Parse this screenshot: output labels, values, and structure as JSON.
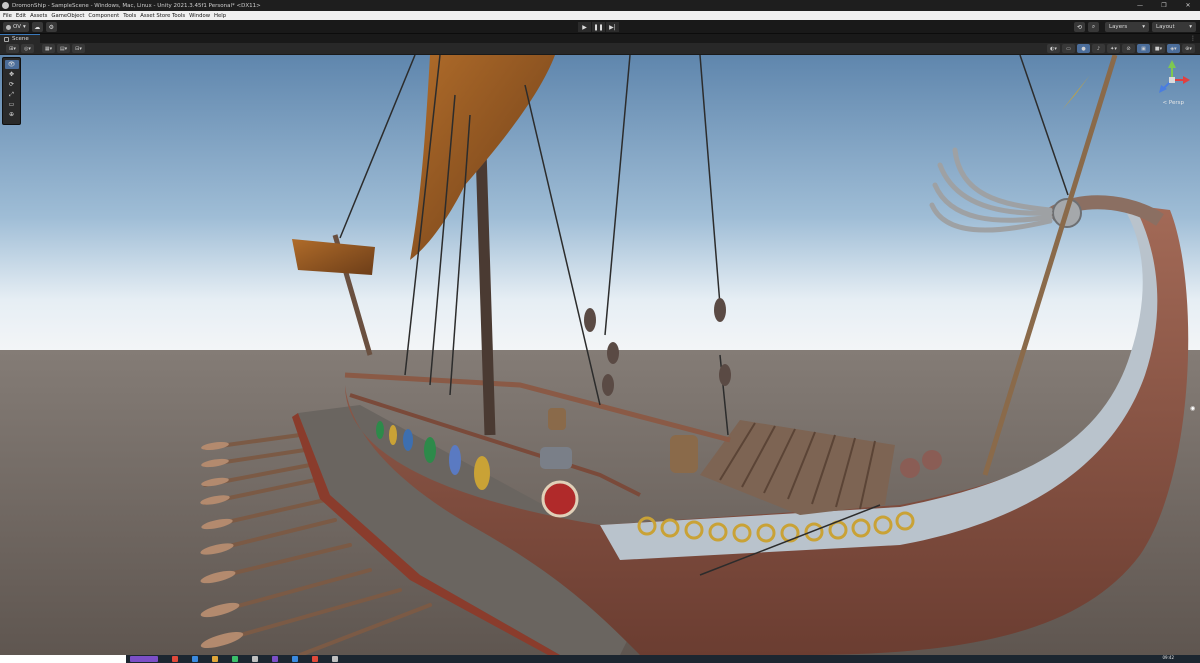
{
  "window": {
    "title": "DromonShip - SampleScene - Windows, Mac, Linux - Unity 2021.3.45f1 Personal* <DX11>",
    "controls": [
      "—",
      "❐",
      "✕"
    ]
  },
  "menu": {
    "items": [
      "File",
      "Edit",
      "Assets",
      "GameObject",
      "Component",
      "Tools",
      "Asset Store Tools",
      "Window",
      "Help"
    ]
  },
  "toolbar": {
    "account_label": "OV",
    "account_icon": "account-icon",
    "cloud_icon": "cloud-icon",
    "settings_icon": "gear-icon",
    "play_icons": [
      "play-icon",
      "pause-icon",
      "step-icon"
    ],
    "play_glyphs": [
      "▶",
      "❚❚",
      "▶|"
    ],
    "history_icon": "history-icon",
    "search_icon": "search-icon",
    "layers_label": "Layers",
    "layout_label": "Layout"
  },
  "scene_tab": {
    "label": "Scene"
  },
  "scene_tools": {
    "tools": [
      "view-tool",
      "move-tool",
      "rotate-tool",
      "scale-tool",
      "rect-tool",
      "transform-tool"
    ],
    "glyphs": [
      "👁",
      "✥",
      "⟳",
      "⤢",
      "▭",
      "⊕"
    ]
  },
  "gizmo": {
    "label": "< Persp"
  },
  "taskbar": {
    "time": "09:42"
  },
  "colors": {
    "accent": "#3a79bb",
    "sky_top": "#5f86ad",
    "ground": "#6b625a",
    "hull": "#7a4a3a"
  }
}
